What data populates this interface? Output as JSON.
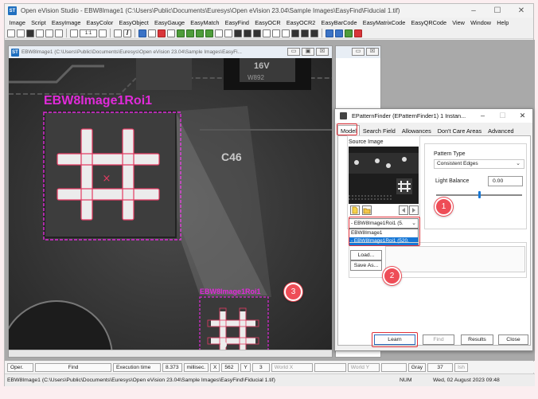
{
  "app": {
    "title": "Open eVision Studio - EBW8Image1 (C:\\Users\\Public\\Documents\\Euresys\\Open eVision 23.04\\Sample Images\\EasyFind\\Fiducial 1.tif)",
    "icon_text": "ST",
    "window_controls": [
      "–",
      "☐",
      "✕"
    ]
  },
  "menu": [
    "Image",
    "Script",
    "EasyImage",
    "EasyColor",
    "EasyObject",
    "EasyGauge",
    "EasyMatch",
    "EasyFind",
    "EasyOCR",
    "EasyOCR2",
    "EasyBarCode",
    "EasyMatrixCode",
    "EasyQRCode",
    "View",
    "Window",
    "Help"
  ],
  "toolbar": {
    "zoom": "1:1",
    "bold_glyph": "I"
  },
  "image_window": {
    "title": "EBW8Image1 (C:\\Users\\Public\\Documents\\Euresys\\Open eVision 23.04\\Sample Images\\EasyFi...",
    "buttons": [
      "▭",
      "▣",
      "☒"
    ],
    "roi_label": "EBW8Image1Roi1",
    "small_roi_label": "EBW8Image1Roi1",
    "board_text": "C46",
    "chip_text_1": "16V",
    "chip_text_2": "W892"
  },
  "bg_window": {
    "buttons": [
      "▭",
      "☒"
    ]
  },
  "dialog": {
    "title": "EPatternFinder (EPatternFinder1) 1 Instan...",
    "controls": [
      "–",
      "☐",
      "✕"
    ],
    "tabs": [
      "Model",
      "Search Field",
      "Allowances",
      "Don't Care Areas",
      "Advanced"
    ],
    "active_tab": "Model",
    "source_image_label": "Source Image",
    "source_combo_value": "- EBW8Image1Roi1 (5.",
    "dropdown_options": [
      "EBW8Image1",
      " - EBW8Image1Roi1 (520,"
    ],
    "selected_option_index": 1,
    "pattern_type_label": "Pattern Type",
    "pattern_type_value": "Consistent Edges",
    "light_balance_label": "Light Balance",
    "light_balance_value": "0.00",
    "light_balance_level": 0.5,
    "load_button": "Load...",
    "save_button": "Save As...",
    "learn_button": "Learn",
    "find_button": "Find",
    "results_button": "Results",
    "close_button": "Close"
  },
  "callouts": [
    "1",
    "2",
    "3"
  ],
  "statusbar": {
    "mode": "Oper.",
    "action": "Find",
    "exec_label": "Execution time",
    "exec_value": "8.373",
    "exec_unit": "millisec.",
    "x_label": "X",
    "x_value": "562",
    "y_label": "Y",
    "y_value": "3",
    "world_x": "World X",
    "world_y": "World Y",
    "gray_label": "Gray",
    "gray_value": "37",
    "ish": "Ish"
  },
  "footer": {
    "path": "EBW8Image1 (C:\\Users\\Public\\Documents\\Euresys\\Open eVision 23.04\\Sample Images\\EasyFind\\Fiducial 1.tif)",
    "num": "NUM",
    "datetime": "Wed, 02 August 2023  09:48"
  },
  "colors": {
    "roi": "#e02ad9",
    "callout": "#ee4d57",
    "highlight": "#e0313a",
    "accent": "#1677d6"
  }
}
